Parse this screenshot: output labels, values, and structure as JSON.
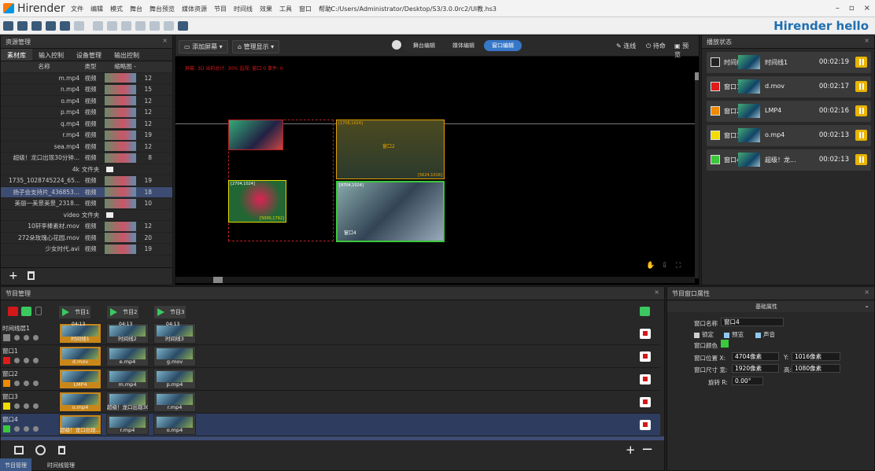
{
  "app": {
    "name": "Hirender",
    "menu": [
      "文件",
      "编辑",
      "模式",
      "舞台",
      "舞台预览",
      "媒体资源",
      "节目",
      "时间线",
      "效果",
      "工具",
      "窗口",
      "帮助"
    ],
    "path": "- C:/Users/Administrator/Desktop/S3/3.0.0rc2/UI教.hs3",
    "brand": "Hirender hello",
    "win_controls": [
      "–",
      "▫",
      "×"
    ]
  },
  "resources": {
    "title": "资源管理",
    "tabs": [
      "素材库",
      "输入控制",
      "设备管理",
      "输出控制"
    ],
    "cols": [
      "名称",
      "类型",
      "缩略图 -"
    ],
    "rows": [
      {
        "name": "m.mp4",
        "type": "视频",
        "num": "12"
      },
      {
        "name": "n.mp4",
        "type": "视频",
        "num": "15"
      },
      {
        "name": "o.mp4",
        "type": "视频",
        "num": "12"
      },
      {
        "name": "p.mp4",
        "type": "视频",
        "num": "12"
      },
      {
        "name": "q.mp4",
        "type": "视频",
        "num": "12"
      },
      {
        "name": "r.mp4",
        "type": "视频",
        "num": "19"
      },
      {
        "name": "sea.mp4",
        "type": "视频",
        "num": "12"
      },
      {
        "name": "超级！龙口出现30分钟...",
        "type": "视频",
        "num": "8"
      },
      {
        "name": "4k",
        "type": "文件夹",
        "num": ""
      },
      {
        "name": "1735_1028745224_65...",
        "type": "视频",
        "num": "19"
      },
      {
        "name": "扬子会支持片_436853...",
        "type": "视频",
        "num": "18"
      },
      {
        "name": "美丽一美景美景_2318...",
        "type": "视频",
        "num": "10"
      },
      {
        "name": "video",
        "type": "文件夹",
        "num": ""
      },
      {
        "name": "10轩李棒素材.mov",
        "type": "视频",
        "num": "12"
      },
      {
        "name": "272朵玫瑰心花园.mov",
        "type": "视频",
        "num": "20"
      },
      {
        "name": "少女时代.avi",
        "type": "视频",
        "num": "19"
      }
    ]
  },
  "stage": {
    "add_screen": "添加屏幕",
    "manage_display": "管理显示",
    "modes": [
      "舞台编辑",
      "媒体编辑",
      "窗口编辑"
    ],
    "online": "连线",
    "standby": "待命",
    "preview": "预览",
    "info": "屏幕: 3D 当前总计: 30% 监视: 窗口 0 事件: 0",
    "window_labels": [
      "窗口2",
      "[1708,1024]",
      "[2704,1024]",
      "[4704,1024]",
      "[5624,1016]",
      "[5000,1792]",
      "窗口4"
    ]
  },
  "play_state": {
    "title": "播放状态",
    "rows": [
      {
        "label": "时间线层1",
        "file": "时间线1",
        "time": "00:02:19",
        "color": "#222222"
      },
      {
        "label": "窗口1",
        "file": "d.mov",
        "time": "00:02:17",
        "color": "#e01b1b"
      },
      {
        "label": "窗口2",
        "file": "LMP4",
        "time": "00:02:16",
        "color": "#f08a00"
      },
      {
        "label": "窗口3",
        "file": "o.mp4",
        "time": "00:02:13",
        "color": "#f0dc00"
      },
      {
        "label": "窗口4",
        "file": "超级！龙...",
        "time": "00:02:13",
        "color": "#3cc83c"
      }
    ]
  },
  "program": {
    "title": "节目管理",
    "tabs": [
      "节目1",
      "节目2",
      "节目3"
    ],
    "marks": [
      "04:13",
      "04:13",
      "04:13"
    ],
    "tracks": [
      {
        "name": "时间线层1",
        "clips": [
          "时间线1",
          "时间线2",
          "时间线3"
        ]
      },
      {
        "name": "窗口1",
        "clips": [
          "d.mov",
          "e.mp4",
          "g.mov"
        ]
      },
      {
        "name": "窗口2",
        "clips": [
          "LMP4",
          "m.mp4",
          "p.mp4"
        ]
      },
      {
        "name": "窗口3",
        "clips": [
          "o.mp4",
          "超级！龙口出现30...",
          "r.mp4"
        ]
      },
      {
        "name": "窗口4",
        "clips": [
          "超级！龙口出现...",
          "r.mp4",
          "o.mp4"
        ]
      }
    ],
    "bottom_tabs": [
      "节目管理",
      "时间线管理"
    ]
  },
  "props": {
    "title": "节目窗口属性",
    "section": "基础属性",
    "name_label": "窗口名称",
    "name_value": "窗口4",
    "lock": "锁定",
    "preview": "预览",
    "sound": "声音",
    "color_label": "窗口颜色",
    "pos_label": "窗口位置 X:",
    "x": "4704像素",
    "y_label": "Y:",
    "y": "1016像素",
    "size_label": "窗口尺寸 宽:",
    "w": "1920像素",
    "h_label": "高:",
    "h": "1080像素",
    "rot_label": "旋转 R:",
    "rot": "0.00°"
  }
}
